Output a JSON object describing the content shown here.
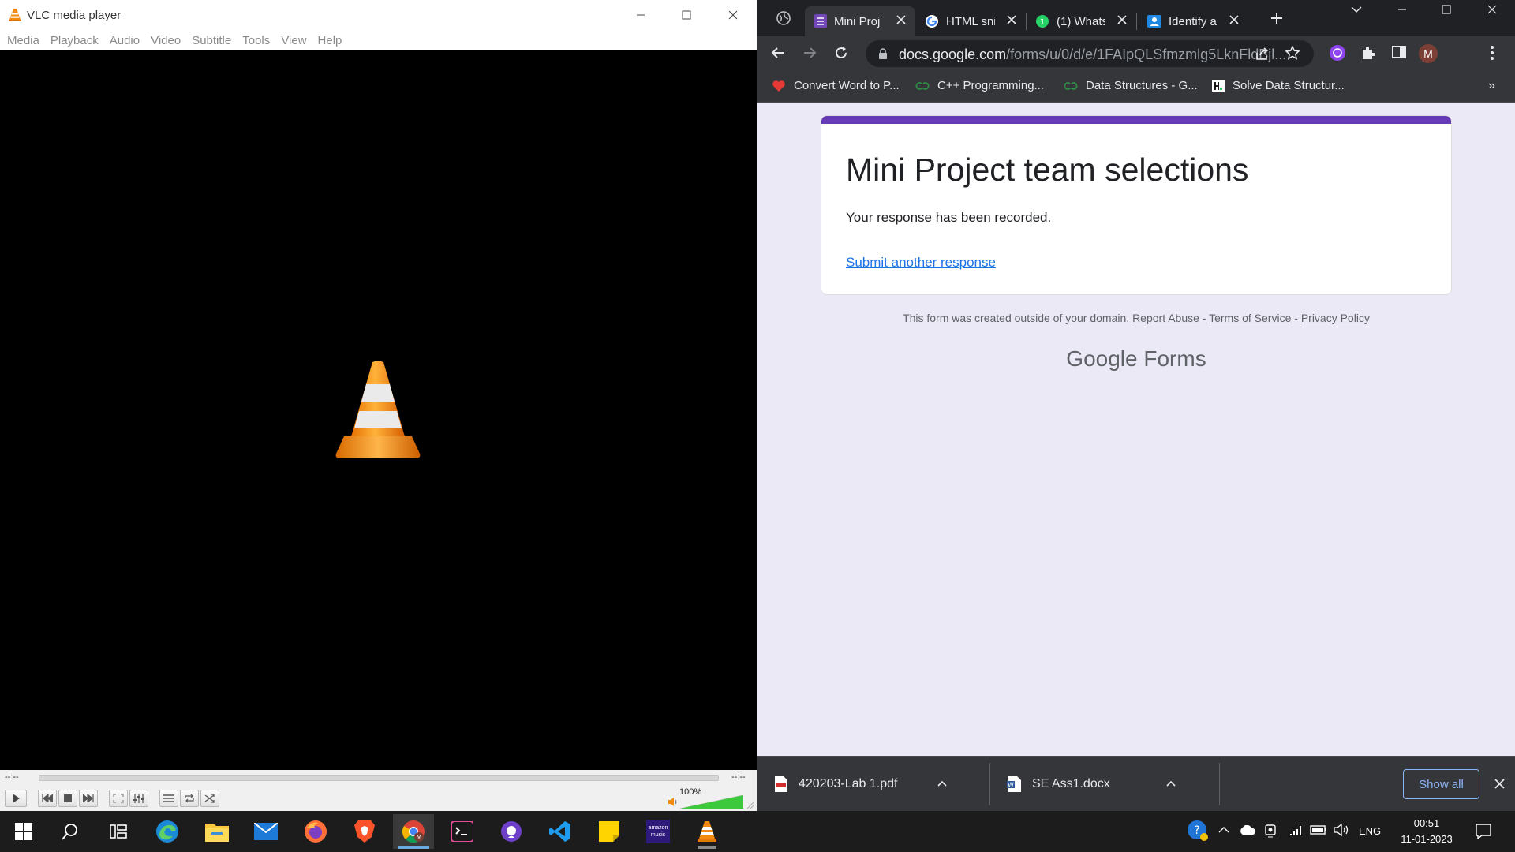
{
  "vlc": {
    "window_title": "VLC media player",
    "menu": [
      "Media",
      "Playback",
      "Audio",
      "Video",
      "Subtitle",
      "Tools",
      "View",
      "Help"
    ],
    "elapsed": "--:--",
    "remaining": "--:--",
    "volume_label": "100%",
    "volume_level": 1.0
  },
  "chrome": {
    "tabs": [
      {
        "title": "Mini Proj",
        "icon": "google-forms-icon",
        "active": true
      },
      {
        "title": "HTML sni",
        "icon": "google-icon",
        "active": false
      },
      {
        "title": "(1) Whats",
        "icon": "whatsapp-icon",
        "active": false
      },
      {
        "title": "Identify a",
        "icon": "google-classroom-icon",
        "active": false
      }
    ],
    "url_domain": "docs.google.com",
    "url_path": "/forms/u/0/d/e/1FAIpQLSfmzmlg5LknFldBjl...",
    "profile_initial": "M",
    "bookmarks": [
      {
        "label": "Convert Word to P...",
        "icon": "heart-icon"
      },
      {
        "label": "C++ Programming...",
        "icon": "geeksforgeeks-icon"
      },
      {
        "label": "Data Structures - G...",
        "icon": "geeksforgeeks-icon"
      },
      {
        "label": "Solve Data Structur...",
        "icon": "hackerrank-icon"
      }
    ],
    "bookmarks_overflow": "»",
    "form": {
      "title": "Mini Project team selections",
      "message": "Your response has been recorded.",
      "another_link": "Submit another response",
      "footer_prefix": "This form was created outside of your domain.",
      "report_abuse": "Report Abuse",
      "terms": "Terms of Service",
      "privacy": "Privacy Policy",
      "separator": "-",
      "brand_google": "Google",
      "brand_forms": "Forms"
    },
    "downloads": [
      {
        "name": "420203-Lab 1.pdf",
        "icon": "pdf-file-icon"
      },
      {
        "name": "SE Ass1.docx",
        "icon": "word-file-icon"
      }
    ],
    "show_all": "Show all"
  },
  "taskbar": {
    "apps": [
      "start-icon",
      "search-icon",
      "task-view-icon",
      "edge-icon",
      "file-explorer-icon",
      "mail-icon",
      "firefox-icon",
      "brave-icon",
      "chrome-icon",
      "terminal-icon",
      "github-desktop-icon",
      "vscode-icon",
      "sticky-notes-icon",
      "amazon-music-icon",
      "vlc-icon"
    ],
    "amazon_music_label": "amazon music",
    "language": "ENG",
    "time": "00:51",
    "date": "11-01-2023"
  },
  "colors": {
    "form_accent": "#673ab7",
    "link": "#1a73e8",
    "page_bg": "#ece9f6",
    "vlc_orange": "#f28a0c"
  }
}
